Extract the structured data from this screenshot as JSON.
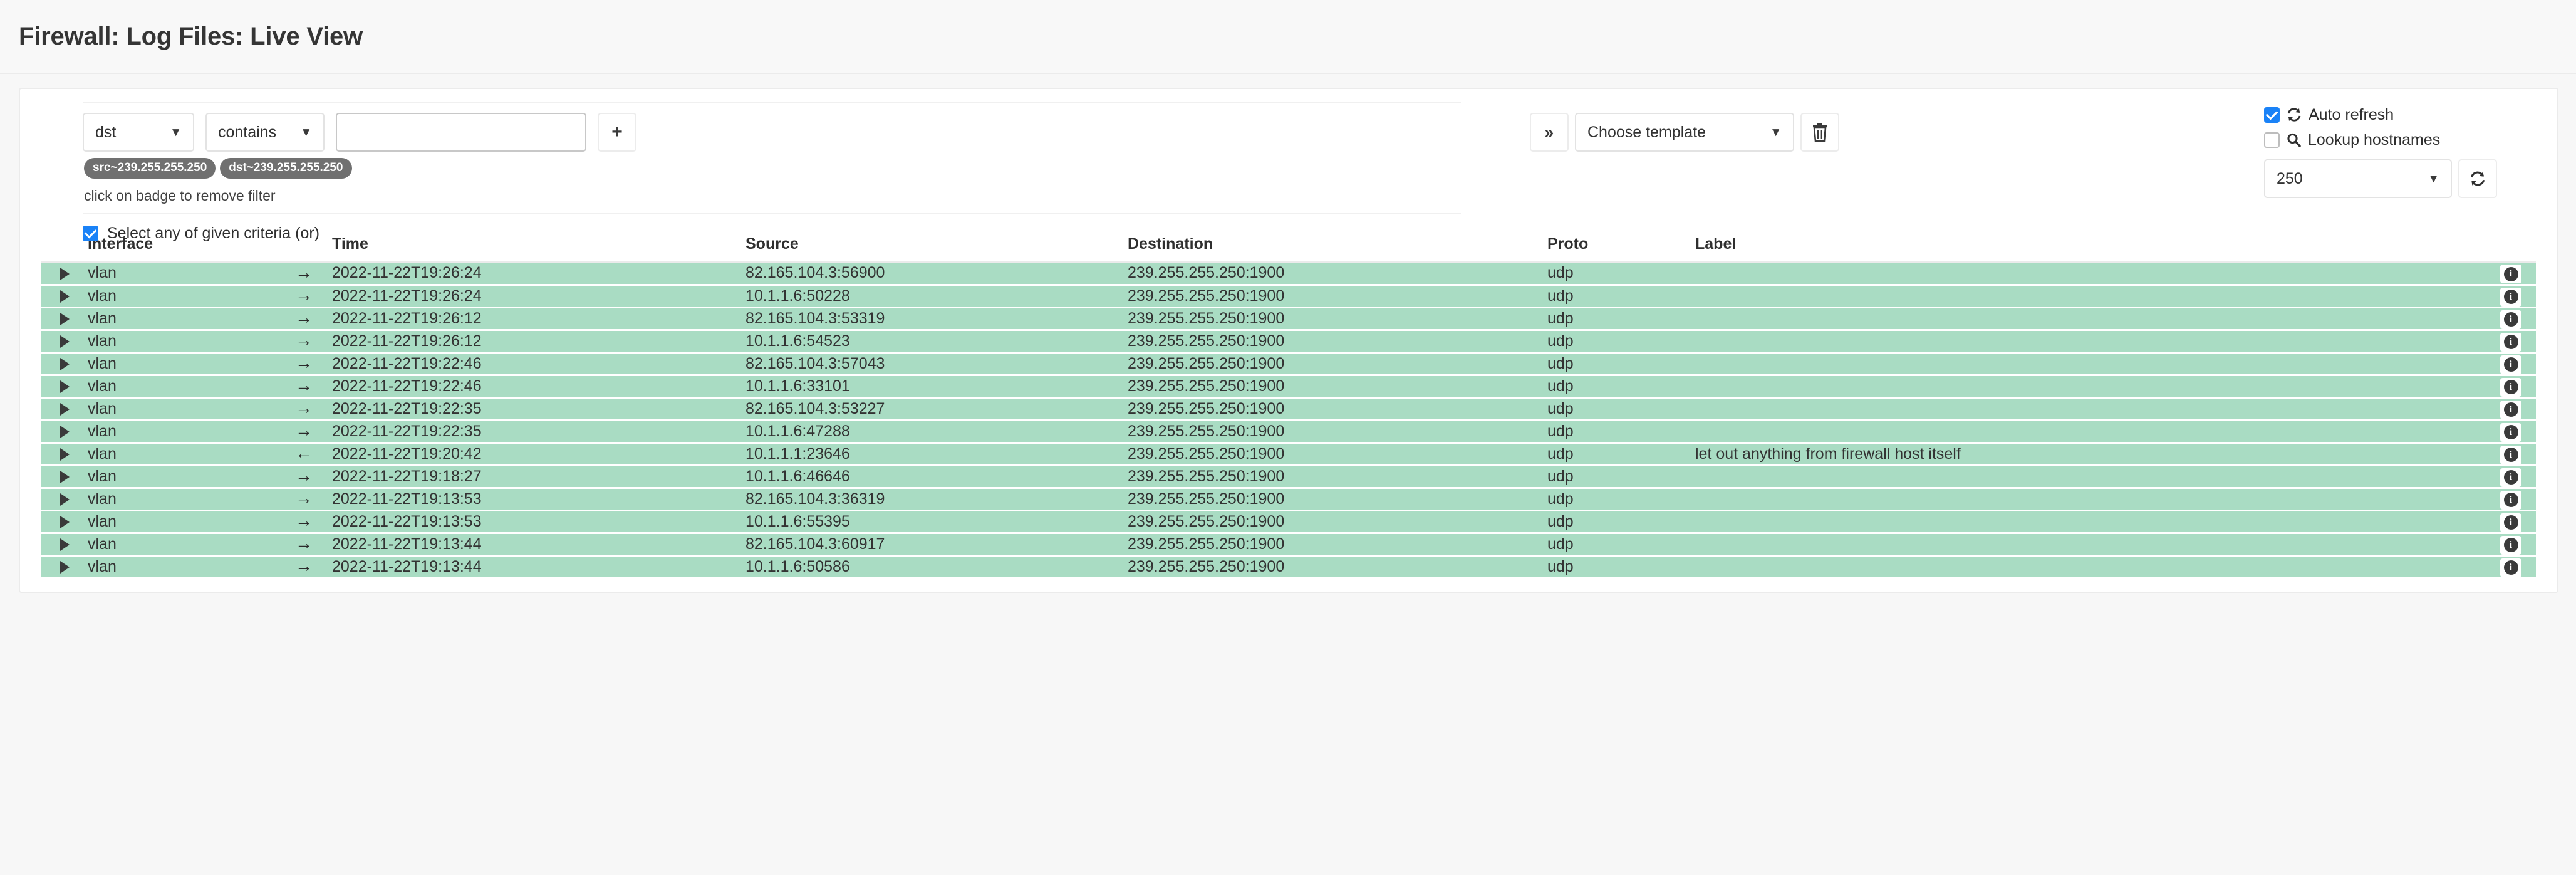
{
  "header": {
    "title": "Firewall: Log Files: Live View"
  },
  "filter": {
    "field_select": {
      "value": "dst",
      "icon": "chevron-down-icon"
    },
    "operator_select": {
      "value": "contains",
      "icon": "chevron-down-icon"
    },
    "value_input": {
      "value": "",
      "placeholder": ""
    },
    "add_button": {
      "label": "+",
      "icon": "plus-icon"
    },
    "badges": [
      {
        "label": "src~239.255.255.250"
      },
      {
        "label": "dst~239.255.255.250"
      }
    ],
    "badge_hint": "click on badge to remove filter",
    "criteria_checkbox": {
      "label": "Select any of given criteria (or)",
      "checked": true
    }
  },
  "template": {
    "expand_button": {
      "label": "»",
      "icon": "chevron-double-right-icon"
    },
    "select": {
      "value": "Choose template",
      "icon": "chevron-down-icon"
    },
    "delete_button": {
      "icon": "trash-icon"
    }
  },
  "options": {
    "auto_refresh": {
      "label": "Auto refresh",
      "checked": true,
      "icon": "refresh-icon"
    },
    "lookup_hostnames": {
      "label": "Lookup hostnames",
      "checked": false,
      "icon": "search-icon"
    },
    "limit_select": {
      "value": "250",
      "icon": "chevron-down-icon"
    },
    "refresh_button": {
      "icon": "refresh-icon"
    }
  },
  "table": {
    "columns": [
      "Interface",
      "Time",
      "Source",
      "Destination",
      "Proto",
      "Label"
    ],
    "rows": [
      {
        "interface": "vlan",
        "direction": "out",
        "time": "2022-11-22T19:26:24",
        "source": "82.165.104.3:56900",
        "destination": "239.255.255.250:1900",
        "proto": "udp",
        "label": ""
      },
      {
        "interface": "vlan",
        "direction": "out",
        "time": "2022-11-22T19:26:24",
        "source": "10.1.1.6:50228",
        "destination": "239.255.255.250:1900",
        "proto": "udp",
        "label": ""
      },
      {
        "interface": "vlan",
        "direction": "out",
        "time": "2022-11-22T19:26:12",
        "source": "82.165.104.3:53319",
        "destination": "239.255.255.250:1900",
        "proto": "udp",
        "label": ""
      },
      {
        "interface": "vlan",
        "direction": "out",
        "time": "2022-11-22T19:26:12",
        "source": "10.1.1.6:54523",
        "destination": "239.255.255.250:1900",
        "proto": "udp",
        "label": ""
      },
      {
        "interface": "vlan",
        "direction": "out",
        "time": "2022-11-22T19:22:46",
        "source": "82.165.104.3:57043",
        "destination": "239.255.255.250:1900",
        "proto": "udp",
        "label": ""
      },
      {
        "interface": "vlan",
        "direction": "out",
        "time": "2022-11-22T19:22:46",
        "source": "10.1.1.6:33101",
        "destination": "239.255.255.250:1900",
        "proto": "udp",
        "label": ""
      },
      {
        "interface": "vlan",
        "direction": "out",
        "time": "2022-11-22T19:22:35",
        "source": "82.165.104.3:53227",
        "destination": "239.255.255.250:1900",
        "proto": "udp",
        "label": ""
      },
      {
        "interface": "vlan",
        "direction": "out",
        "time": "2022-11-22T19:22:35",
        "source": "10.1.1.6:47288",
        "destination": "239.255.255.250:1900",
        "proto": "udp",
        "label": ""
      },
      {
        "interface": "vlan",
        "direction": "in",
        "time": "2022-11-22T19:20:42",
        "source": "10.1.1.1:23646",
        "destination": "239.255.255.250:1900",
        "proto": "udp",
        "label": "let out anything from firewall host itself"
      },
      {
        "interface": "vlan",
        "direction": "out",
        "time": "2022-11-22T19:18:27",
        "source": "10.1.1.6:46646",
        "destination": "239.255.255.250:1900",
        "proto": "udp",
        "label": ""
      },
      {
        "interface": "vlan",
        "direction": "out",
        "time": "2022-11-22T19:13:53",
        "source": "82.165.104.3:36319",
        "destination": "239.255.255.250:1900",
        "proto": "udp",
        "label": ""
      },
      {
        "interface": "vlan",
        "direction": "out",
        "time": "2022-11-22T19:13:53",
        "source": "10.1.1.6:55395",
        "destination": "239.255.255.250:1900",
        "proto": "udp",
        "label": ""
      },
      {
        "interface": "vlan",
        "direction": "out",
        "time": "2022-11-22T19:13:44",
        "source": "82.165.104.3:60917",
        "destination": "239.255.255.250:1900",
        "proto": "udp",
        "label": ""
      },
      {
        "interface": "vlan",
        "direction": "out",
        "time": "2022-11-22T19:13:44",
        "source": "10.1.1.6:50586",
        "destination": "239.255.255.250:1900",
        "proto": "udp",
        "label": ""
      }
    ],
    "row_icons": {
      "expand": "caret-right-icon",
      "info": "info-icon",
      "out": "arrow-right-icon",
      "in": "arrow-left-icon"
    }
  },
  "colors": {
    "row_green": "#a9dcc3",
    "accent_blue": "#1a82f7",
    "badge_gray": "#707070"
  }
}
